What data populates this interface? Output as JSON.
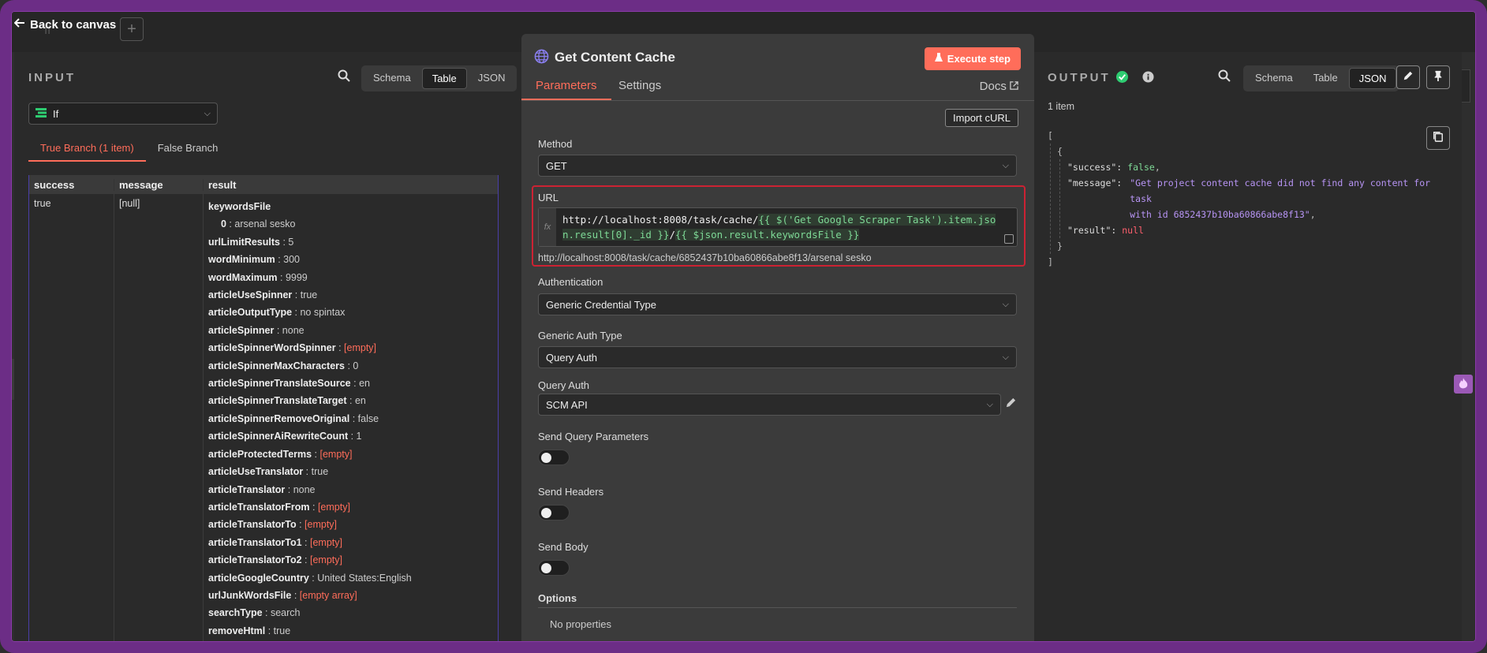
{
  "header": {
    "back_label": "Back to canvas",
    "ghost_node_label": "If"
  },
  "input": {
    "title": "INPUT",
    "view_options": [
      "Schema",
      "Table",
      "JSON"
    ],
    "active_view": "Table",
    "node_select": "If",
    "branch_tabs": [
      "True Branch (1 item)",
      "False Branch"
    ],
    "columns": [
      "success",
      "message",
      "result"
    ],
    "row": {
      "success": "true",
      "message": "[null]",
      "keywords_file_key": "keywordsFile",
      "keywords_file_index": "0",
      "keywords_file_value": "arsenal sesko",
      "fields": [
        {
          "k": "urlLimitResults",
          "v": "5",
          "empty": false
        },
        {
          "k": "wordMinimum",
          "v": "300",
          "empty": false
        },
        {
          "k": "wordMaximum",
          "v": "9999",
          "empty": false
        },
        {
          "k": "articleUseSpinner",
          "v": "true",
          "empty": false
        },
        {
          "k": "articleOutputType",
          "v": "no spintax",
          "empty": false
        },
        {
          "k": "articleSpinner",
          "v": "none",
          "empty": false
        },
        {
          "k": "articleSpinnerWordSpinner",
          "v": "[empty]",
          "empty": true
        },
        {
          "k": "articleSpinnerMaxCharacters",
          "v": "0",
          "empty": false
        },
        {
          "k": "articleSpinnerTranslateSource",
          "v": "en",
          "empty": false
        },
        {
          "k": "articleSpinnerTranslateTarget",
          "v": "en",
          "empty": false
        },
        {
          "k": "articleSpinnerRemoveOriginal",
          "v": "false",
          "empty": false
        },
        {
          "k": "articleSpinnerAiRewriteCount",
          "v": "1",
          "empty": false
        },
        {
          "k": "articleProtectedTerms",
          "v": "[empty]",
          "empty": true
        },
        {
          "k": "articleUseTranslator",
          "v": "true",
          "empty": false
        },
        {
          "k": "articleTranslator",
          "v": "none",
          "empty": false
        },
        {
          "k": "articleTranslatorFrom",
          "v": "[empty]",
          "empty": true
        },
        {
          "k": "articleTranslatorTo",
          "v": "[empty]",
          "empty": true
        },
        {
          "k": "articleTranslatorTo1",
          "v": "[empty]",
          "empty": true
        },
        {
          "k": "articleTranslatorTo2",
          "v": "[empty]",
          "empty": true
        },
        {
          "k": "articleGoogleCountry",
          "v": "United States:English",
          "empty": false
        },
        {
          "k": "urlJunkWordsFile",
          "v": "[empty array]",
          "empty": true
        },
        {
          "k": "searchType",
          "v": "search",
          "empty": false
        },
        {
          "k": "removeHtml",
          "v": "true",
          "empty": false
        }
      ]
    }
  },
  "node": {
    "title": "Get Content Cache",
    "execute_label": "Execute step",
    "tabs": [
      "Parameters",
      "Settings"
    ],
    "docs_label": "Docs",
    "import_label": "Import cURL",
    "method_label": "Method",
    "method_value": "GET",
    "url_label": "URL",
    "url_static": "http://localhost:8008/task/cache/",
    "url_expr1": "{{ $('Get Google Scraper Task').item.json.result[0]._id }}",
    "url_sep": "/",
    "url_expr2": "{{ $json.result.keywordsFile }}",
    "url_preview": "http://localhost:8008/task/cache/6852437b10ba60866abe8f13/arsenal sesko",
    "fx_label": "fx",
    "auth_label": "Authentication",
    "auth_value": "Generic Credential Type",
    "generic_auth_label": "Generic Auth Type",
    "generic_auth_value": "Query Auth",
    "query_auth_label": "Query Auth",
    "query_auth_value": "SCM API",
    "send_query_label": "Send Query Parameters",
    "send_headers_label": "Send Headers",
    "send_body_label": "Send Body",
    "send_query_on": false,
    "send_headers_on": false,
    "send_body_on": false,
    "options_label": "Options",
    "no_props_label": "No properties"
  },
  "output": {
    "title": "OUTPUT",
    "view_options": [
      "Schema",
      "Table",
      "JSON"
    ],
    "active_view": "JSON",
    "count": "1 item",
    "json": {
      "success_key": "\"success\":",
      "success_val": "false",
      "message_key": "\"message\":",
      "message_val_1": "\"Get project content cache did not find any content for task",
      "message_val_2": "with id 6852437b10ba60866abe8f13\"",
      "result_key": "\"result\":",
      "result_val": "null"
    }
  },
  "colors": {
    "accent": "#ff6d5a",
    "success": "#2ecc71",
    "highlight_border": "#cc2233",
    "frame": "#6c2d86"
  }
}
